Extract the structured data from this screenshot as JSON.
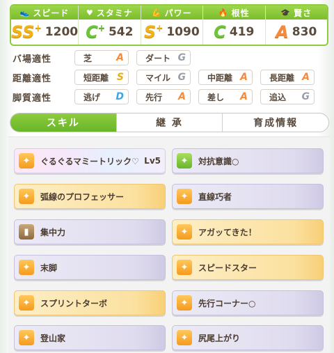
{
  "stats": [
    {
      "label": "スピード",
      "icon": "shoe-icon",
      "grade": "SS",
      "plus": "+",
      "value": "1200"
    },
    {
      "label": "スタミナ",
      "icon": "heart-icon",
      "grade": "C",
      "plus": "+",
      "value": "542"
    },
    {
      "label": "パワー",
      "icon": "muscle-icon",
      "grade": "S",
      "plus": "+",
      "value": "1090"
    },
    {
      "label": "根性",
      "icon": "flame-icon",
      "grade": "C",
      "plus": "",
      "value": "419"
    },
    {
      "label": "賢さ",
      "icon": "grad-cap-icon",
      "grade": "A",
      "plus": "",
      "value": "830"
    }
  ],
  "aptitude": {
    "track": {
      "label": "バ場適性",
      "cells": [
        {
          "name": "芝",
          "grade": "A"
        },
        {
          "name": "ダート",
          "grade": "G"
        }
      ]
    },
    "distance": {
      "label": "距離適性",
      "cells": [
        {
          "name": "短距離",
          "grade": "S"
        },
        {
          "name": "マイル",
          "grade": "G"
        },
        {
          "name": "中距離",
          "grade": "A"
        },
        {
          "name": "長距離",
          "grade": "A"
        }
      ]
    },
    "style": {
      "label": "脚質適性",
      "cells": [
        {
          "name": "逃げ",
          "grade": "D"
        },
        {
          "name": "先行",
          "grade": "A"
        },
        {
          "name": "差し",
          "grade": "A"
        },
        {
          "name": "追込",
          "grade": "G"
        }
      ]
    }
  },
  "tabs": [
    "スキル",
    "継 承",
    "育成情報"
  ],
  "skills": [
    {
      "name": "ぐるぐるマミートリック♡",
      "level": "Lv5",
      "style": "rainbow",
      "icon": "orange"
    },
    {
      "name": "対抗意識○",
      "level": "",
      "style": "purple",
      "icon": "green"
    },
    {
      "name": "弧線のプロフェッサー",
      "level": "",
      "style": "gold",
      "icon": "orange"
    },
    {
      "name": "直線巧者",
      "level": "",
      "style": "purple",
      "icon": "orange"
    },
    {
      "name": "集中力",
      "level": "",
      "style": "purple",
      "icon": "brown"
    },
    {
      "name": "アガッてきた！",
      "level": "",
      "style": "gold",
      "icon": "orange"
    },
    {
      "name": "末脚",
      "level": "",
      "style": "purple",
      "icon": "orange"
    },
    {
      "name": "スピードスター",
      "level": "",
      "style": "gold",
      "icon": "orange"
    },
    {
      "name": "スプリントターボ",
      "level": "",
      "style": "gold",
      "icon": "orange"
    },
    {
      "name": "先行コーナー○",
      "level": "",
      "style": "purple",
      "icon": "orange"
    },
    {
      "name": "登山家",
      "level": "",
      "style": "purple",
      "icon": "orange"
    },
    {
      "name": "尻尾上がり",
      "level": "",
      "style": "purple",
      "icon": "orange"
    }
  ]
}
